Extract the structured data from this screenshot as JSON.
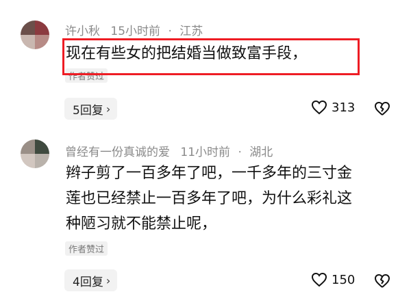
{
  "comments": [
    {
      "author": "许小秋",
      "time": "15小时前",
      "separator": "·",
      "location": "江苏",
      "body_lines": [
        "现在有些女的把结婚当做致富手段，"
      ],
      "author_liked": "作者赞过",
      "replies_label": "5回复",
      "likes": "313",
      "avatar_colors": [
        "#6b4f4a",
        "#8b3a3f",
        "#c9b7b0",
        "#b78b86"
      ],
      "highlighted": true
    },
    {
      "author": "曾经有一份真诚的爱",
      "time": "11小时前",
      "separator": "·",
      "location": "湖北",
      "body_lines": [
        "辫子剪了一百多年了吧，一千多年的三寸金",
        "莲也已经禁止一百多年了吧，为什么彩礼这",
        "种陋习就不能禁止呢，"
      ],
      "author_liked": "作者赞过",
      "replies_label": "4回复",
      "likes": "150",
      "avatar_colors": [
        "#9a8f87",
        "#3f4a3f",
        "#d2c7c0",
        "#b9b2ab"
      ],
      "highlighted": false
    }
  ],
  "colors": {
    "highlight_border": "#ee1c24",
    "meta_text": "#8a8a8a",
    "pill_bg": "#f2f2f2"
  },
  "icons": {
    "heart": "heart-icon",
    "broken_heart": "broken-heart-icon",
    "chevron": "chevron-right-icon"
  }
}
